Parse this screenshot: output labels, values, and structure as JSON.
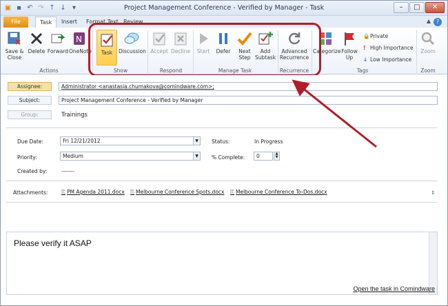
{
  "window": {
    "title": "Project Management Conference - Verified by Manager  -  Task"
  },
  "tabs": [
    {
      "label": "File"
    },
    {
      "label": "Task"
    },
    {
      "label": "Insert"
    },
    {
      "label": "Format Text"
    },
    {
      "label": "Review"
    }
  ],
  "ribbon": {
    "actions": {
      "group_label": "Actions",
      "save_close": "Save & Close",
      "delete": "Delete",
      "forward": "Forward",
      "onenote": "OneNote"
    },
    "show": {
      "group_label": "Show",
      "task": "Task",
      "discussion": "Discussion"
    },
    "respond": {
      "group_label": "Respond",
      "accept": "Accept",
      "decline": "Decline"
    },
    "manage": {
      "group_label": "Manage Task",
      "start": "Start",
      "defer": "Defer",
      "next_step": "Next Step",
      "add_subtask": "Add Subtask"
    },
    "recurrence": {
      "group_label": "Recurrence",
      "advanced": "Advanced Recurrence"
    },
    "tags": {
      "group_label": "Tags",
      "categorize": "Categorize",
      "follow_up": "Follow Up",
      "private": "Private",
      "high": "High Importance",
      "low": "Low Importance"
    },
    "zoom": {
      "group_label": "Zoom",
      "zoom": "Zoom"
    }
  },
  "form": {
    "assignee_label": "Assignee:",
    "assignee_value": "Administrator <anastasia.chumakova@comindware.com>;",
    "subject_label": "Subject:",
    "subject_value": "Project Management Conference - Verified by Manager",
    "group_label": "Group:",
    "group_value": "Trainings",
    "due_label": "Due Date:",
    "due_value": "Fri 12/21/2012",
    "status_label": "Status:",
    "status_value": "In Progress",
    "priority_label": "Priority:",
    "priority_value": "Medium",
    "complete_label": "% Complete:",
    "complete_value": "0",
    "created_label": "Created by:",
    "created_value": "-------",
    "attachments_label": "Attachments:",
    "attachments": [
      "PM Agenda 2011.docx",
      "Melbourne Conference Spots.docx",
      "Melbourne Conference To-Dos.docx"
    ],
    "body_text": "Please verify it ASAP",
    "open_link": "Open the task in Comindware"
  },
  "colors": {
    "accent": "#b01e2a",
    "file_tab": "#e8961f",
    "assignee_bg": "#f6e1a6"
  }
}
